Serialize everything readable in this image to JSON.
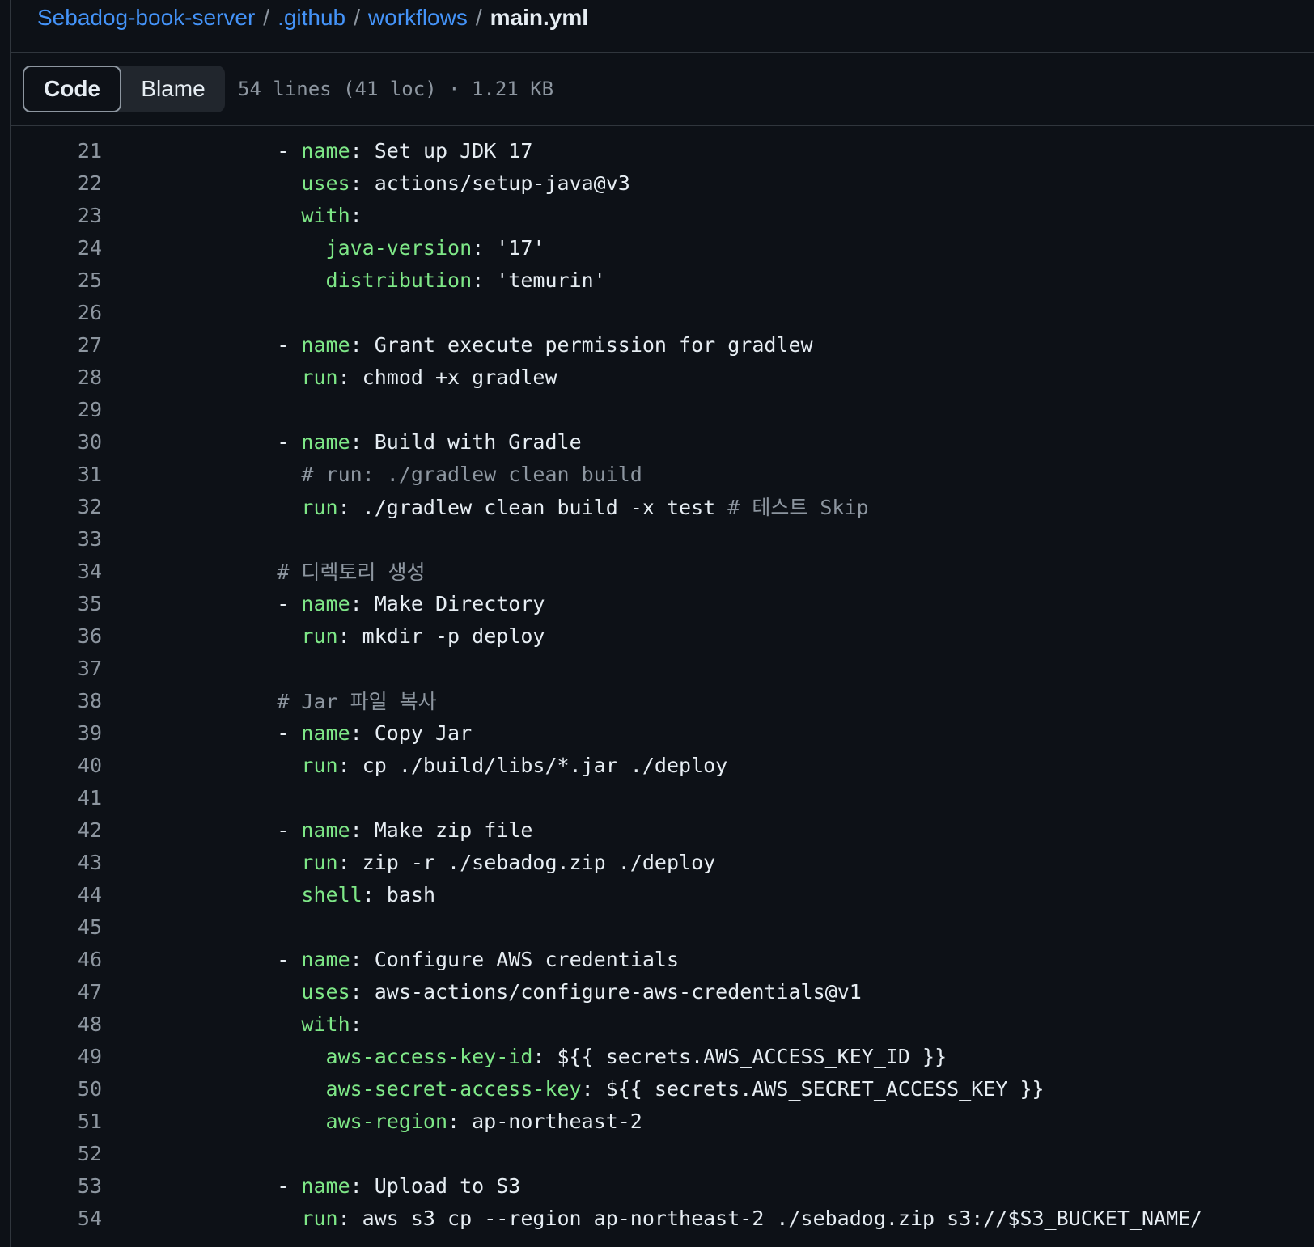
{
  "breadcrumb": {
    "repo": "Sebadog-book-server",
    "dir1": ".github",
    "dir2": "workflows",
    "file": "main.yml",
    "separator": "/"
  },
  "toolbar": {
    "code_label": "Code",
    "blame_label": "Blame",
    "file_info": "54 lines (41 loc) · 1.21 KB"
  },
  "colors": {
    "background": "#0d1117",
    "link": "#4493f8",
    "yaml_key": "#7ee787",
    "comment": "#8d96a0",
    "text": "#e6edf3"
  },
  "code_lines": [
    {
      "n": "21",
      "tokens": [
        {
          "t": "      - ",
          "c": ""
        },
        {
          "t": "name",
          "c": "key"
        },
        {
          "t": ": Set up JDK 17",
          "c": ""
        }
      ]
    },
    {
      "n": "22",
      "tokens": [
        {
          "t": "        ",
          "c": ""
        },
        {
          "t": "uses",
          "c": "key"
        },
        {
          "t": ": actions/setup-java@v3",
          "c": ""
        }
      ]
    },
    {
      "n": "23",
      "tokens": [
        {
          "t": "        ",
          "c": ""
        },
        {
          "t": "with",
          "c": "key"
        },
        {
          "t": ":",
          "c": ""
        }
      ]
    },
    {
      "n": "24",
      "tokens": [
        {
          "t": "          ",
          "c": ""
        },
        {
          "t": "java-version",
          "c": "key"
        },
        {
          "t": ": '17'",
          "c": ""
        }
      ]
    },
    {
      "n": "25",
      "tokens": [
        {
          "t": "          ",
          "c": ""
        },
        {
          "t": "distribution",
          "c": "key"
        },
        {
          "t": ": 'temurin'",
          "c": ""
        }
      ]
    },
    {
      "n": "26",
      "tokens": []
    },
    {
      "n": "27",
      "tokens": [
        {
          "t": "      - ",
          "c": ""
        },
        {
          "t": "name",
          "c": "key"
        },
        {
          "t": ": Grant execute permission for gradlew",
          "c": ""
        }
      ]
    },
    {
      "n": "28",
      "tokens": [
        {
          "t": "        ",
          "c": ""
        },
        {
          "t": "run",
          "c": "key"
        },
        {
          "t": ": chmod +x gradlew",
          "c": ""
        }
      ]
    },
    {
      "n": "29",
      "tokens": []
    },
    {
      "n": "30",
      "tokens": [
        {
          "t": "      - ",
          "c": ""
        },
        {
          "t": "name",
          "c": "key"
        },
        {
          "t": ": Build with Gradle",
          "c": ""
        }
      ]
    },
    {
      "n": "31",
      "tokens": [
        {
          "t": "        ",
          "c": ""
        },
        {
          "t": "# run: ./gradlew clean build",
          "c": "cmt"
        }
      ]
    },
    {
      "n": "32",
      "tokens": [
        {
          "t": "        ",
          "c": ""
        },
        {
          "t": "run",
          "c": "key"
        },
        {
          "t": ": ./gradlew clean build -x test ",
          "c": ""
        },
        {
          "t": "# 테스트 Skip",
          "c": "cmt"
        }
      ]
    },
    {
      "n": "33",
      "tokens": []
    },
    {
      "n": "34",
      "tokens": [
        {
          "t": "      ",
          "c": ""
        },
        {
          "t": "# 디렉토리 생성",
          "c": "cmt"
        }
      ]
    },
    {
      "n": "35",
      "tokens": [
        {
          "t": "      - ",
          "c": ""
        },
        {
          "t": "name",
          "c": "key"
        },
        {
          "t": ": Make Directory",
          "c": ""
        }
      ]
    },
    {
      "n": "36",
      "tokens": [
        {
          "t": "        ",
          "c": ""
        },
        {
          "t": "run",
          "c": "key"
        },
        {
          "t": ": mkdir -p deploy",
          "c": ""
        }
      ]
    },
    {
      "n": "37",
      "tokens": []
    },
    {
      "n": "38",
      "tokens": [
        {
          "t": "      ",
          "c": ""
        },
        {
          "t": "# Jar 파일 복사",
          "c": "cmt"
        }
      ]
    },
    {
      "n": "39",
      "tokens": [
        {
          "t": "      - ",
          "c": ""
        },
        {
          "t": "name",
          "c": "key"
        },
        {
          "t": ": Copy Jar",
          "c": ""
        }
      ]
    },
    {
      "n": "40",
      "tokens": [
        {
          "t": "        ",
          "c": ""
        },
        {
          "t": "run",
          "c": "key"
        },
        {
          "t": ": cp ./build/libs/*.jar ./deploy",
          "c": ""
        }
      ]
    },
    {
      "n": "41",
      "tokens": []
    },
    {
      "n": "42",
      "tokens": [
        {
          "t": "      - ",
          "c": ""
        },
        {
          "t": "name",
          "c": "key"
        },
        {
          "t": ": Make zip file",
          "c": ""
        }
      ]
    },
    {
      "n": "43",
      "tokens": [
        {
          "t": "        ",
          "c": ""
        },
        {
          "t": "run",
          "c": "key"
        },
        {
          "t": ": zip -r ./sebadog.zip ./deploy",
          "c": ""
        }
      ]
    },
    {
      "n": "44",
      "tokens": [
        {
          "t": "        ",
          "c": ""
        },
        {
          "t": "shell",
          "c": "key"
        },
        {
          "t": ": bash",
          "c": ""
        }
      ]
    },
    {
      "n": "45",
      "tokens": []
    },
    {
      "n": "46",
      "tokens": [
        {
          "t": "      - ",
          "c": ""
        },
        {
          "t": "name",
          "c": "key"
        },
        {
          "t": ": Configure AWS credentials",
          "c": ""
        }
      ]
    },
    {
      "n": "47",
      "tokens": [
        {
          "t": "        ",
          "c": ""
        },
        {
          "t": "uses",
          "c": "key"
        },
        {
          "t": ": aws-actions/configure-aws-credentials@v1",
          "c": ""
        }
      ]
    },
    {
      "n": "48",
      "tokens": [
        {
          "t": "        ",
          "c": ""
        },
        {
          "t": "with",
          "c": "key"
        },
        {
          "t": ":",
          "c": ""
        }
      ]
    },
    {
      "n": "49",
      "tokens": [
        {
          "t": "          ",
          "c": ""
        },
        {
          "t": "aws-access-key-id",
          "c": "key"
        },
        {
          "t": ": ${{ secrets.AWS_ACCESS_KEY_ID }}",
          "c": ""
        }
      ]
    },
    {
      "n": "50",
      "tokens": [
        {
          "t": "          ",
          "c": ""
        },
        {
          "t": "aws-secret-access-key",
          "c": "key"
        },
        {
          "t": ": ${{ secrets.AWS_SECRET_ACCESS_KEY }}",
          "c": ""
        }
      ]
    },
    {
      "n": "51",
      "tokens": [
        {
          "t": "          ",
          "c": ""
        },
        {
          "t": "aws-region",
          "c": "key"
        },
        {
          "t": ": ap-northeast-2",
          "c": ""
        }
      ]
    },
    {
      "n": "52",
      "tokens": []
    },
    {
      "n": "53",
      "tokens": [
        {
          "t": "      - ",
          "c": ""
        },
        {
          "t": "name",
          "c": "key"
        },
        {
          "t": ": Upload to S3",
          "c": ""
        }
      ]
    },
    {
      "n": "54",
      "tokens": [
        {
          "t": "        ",
          "c": ""
        },
        {
          "t": "run",
          "c": "key"
        },
        {
          "t": ": aws s3 cp --region ap-northeast-2 ./sebadog.zip s3://$S3_BUCKET_NAME/",
          "c": ""
        }
      ]
    }
  ]
}
